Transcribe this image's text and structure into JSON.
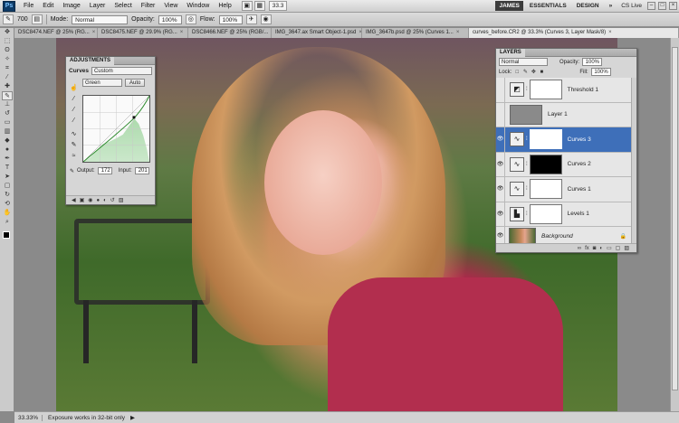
{
  "app": {
    "logo": "Ps"
  },
  "menubar": {
    "items": [
      "File",
      "Edit",
      "Image",
      "Layer",
      "Select",
      "Filter",
      "View",
      "Window",
      "Help"
    ],
    "zoom": "33.3",
    "workspaces": [
      "JAMES",
      "ESSENTIALS",
      "DESIGN"
    ],
    "active_workspace": "JAMES",
    "cs_live": "CS Live"
  },
  "options": {
    "brush_size": "700",
    "mode_label": "Mode:",
    "mode_value": "Normal",
    "opacity_label": "Opacity:",
    "opacity_value": "100%",
    "flow_label": "Flow:",
    "flow_value": "100%"
  },
  "tabs": [
    {
      "label": "DSC8474.NEF @ 25% (RG..."
    },
    {
      "label": "DSC8475.NEF @ 29.9% (RG..."
    },
    {
      "label": "DSC8466.NEF @ 25% (RGB/..."
    },
    {
      "label": "IMG_3647.ax Smart Object-1.psd"
    },
    {
      "label": "IMG_3647b.psd @ 25% (Curves 1..."
    },
    {
      "label": "curves_before.CR2 @ 33.3% (Curves 3, Layer Mask/8)"
    }
  ],
  "adjustments": {
    "title": "ADJUSTMENTS",
    "preset_label": "Curves",
    "preset_value": "Custom",
    "channel": "Green",
    "auto_label": "Auto",
    "output_label": "Output:",
    "output_value": "172",
    "input_label": "Input:",
    "input_value": "201"
  },
  "layers": {
    "title": "LAYERS",
    "blend_mode": "Normal",
    "opacity_label": "Opacity:",
    "opacity_value": "100%",
    "lock_label": "Lock:",
    "fill_label": "Fill:",
    "fill_value": "100%",
    "items": [
      {
        "name": "Threshold 1",
        "visible": false,
        "selected": false,
        "mask": "white"
      },
      {
        "name": "Layer 1",
        "visible": false,
        "selected": false,
        "mask": "none"
      },
      {
        "name": "Curves 3",
        "visible": true,
        "selected": true,
        "mask": "white"
      },
      {
        "name": "Curves 2",
        "visible": true,
        "selected": false,
        "mask": "black"
      },
      {
        "name": "Curves 1",
        "visible": true,
        "selected": false,
        "mask": "white"
      },
      {
        "name": "Levels 1",
        "visible": true,
        "selected": false,
        "mask": "white"
      },
      {
        "name": "Background",
        "visible": true,
        "selected": false,
        "mask": "none"
      }
    ]
  },
  "status": {
    "zoom": "33.33%",
    "message": "Exposure works in 32-bit only"
  },
  "colors": {
    "selected_layer": "#3e6fb9",
    "active_workspace": "#3c3c3c"
  }
}
